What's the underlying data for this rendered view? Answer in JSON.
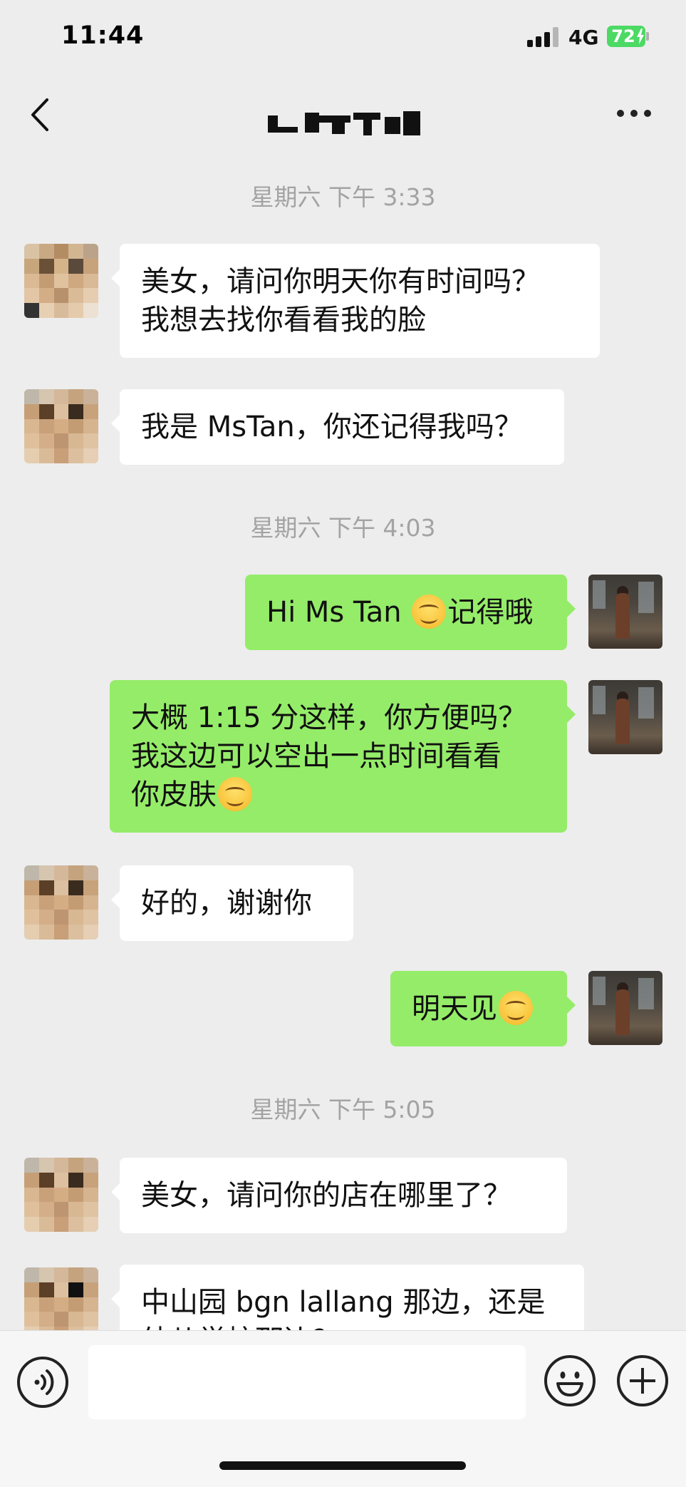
{
  "status_bar": {
    "time": "11:44",
    "network": "4G",
    "battery": "72"
  },
  "header": {
    "back_icon": "chevron-left-icon",
    "more_icon": "ellipsis-icon"
  },
  "timestamps": [
    "星期六 下午 3:33",
    "星期六 下午 4:03",
    "星期六 下午 5:05"
  ],
  "messages": [
    {
      "side": "in",
      "text": "美女，请问你明天你有时间吗？\n我想去找你看看我的脸"
    },
    {
      "side": "in",
      "text": "我是 MsTan，你还记得我吗？"
    },
    {
      "side": "out",
      "text_before": "Hi Ms Tan ",
      "emoji": "smile-emoji",
      "text_after": "记得哦"
    },
    {
      "side": "out",
      "text_before": "大概 1:15 分这样，你方便吗？\n我这边可以空出一点时间看看\n你皮肤",
      "emoji": "smile-emoji",
      "text_after": ""
    },
    {
      "side": "in",
      "text": "好的，谢谢你"
    },
    {
      "side": "out",
      "text_before": "明天见",
      "emoji": "smile-emoji",
      "text_after": ""
    },
    {
      "side": "in",
      "text": "美女，请问你的店在哪里了？"
    },
    {
      "side": "in",
      "text": "中山园 bgn lallang 那边，还是\n幼儿学校那边？"
    }
  ],
  "input_bar": {
    "voice_icon": "voice-icon",
    "emoji_icon": "emoji-face-icon",
    "plus_icon": "plus-icon",
    "input_value": ""
  },
  "colors": {
    "background": "#ededed",
    "incoming_bubble": "#ffffff",
    "outgoing_bubble": "#95ec69",
    "timestamp": "#a3a3a3",
    "battery": "#4cd964"
  }
}
